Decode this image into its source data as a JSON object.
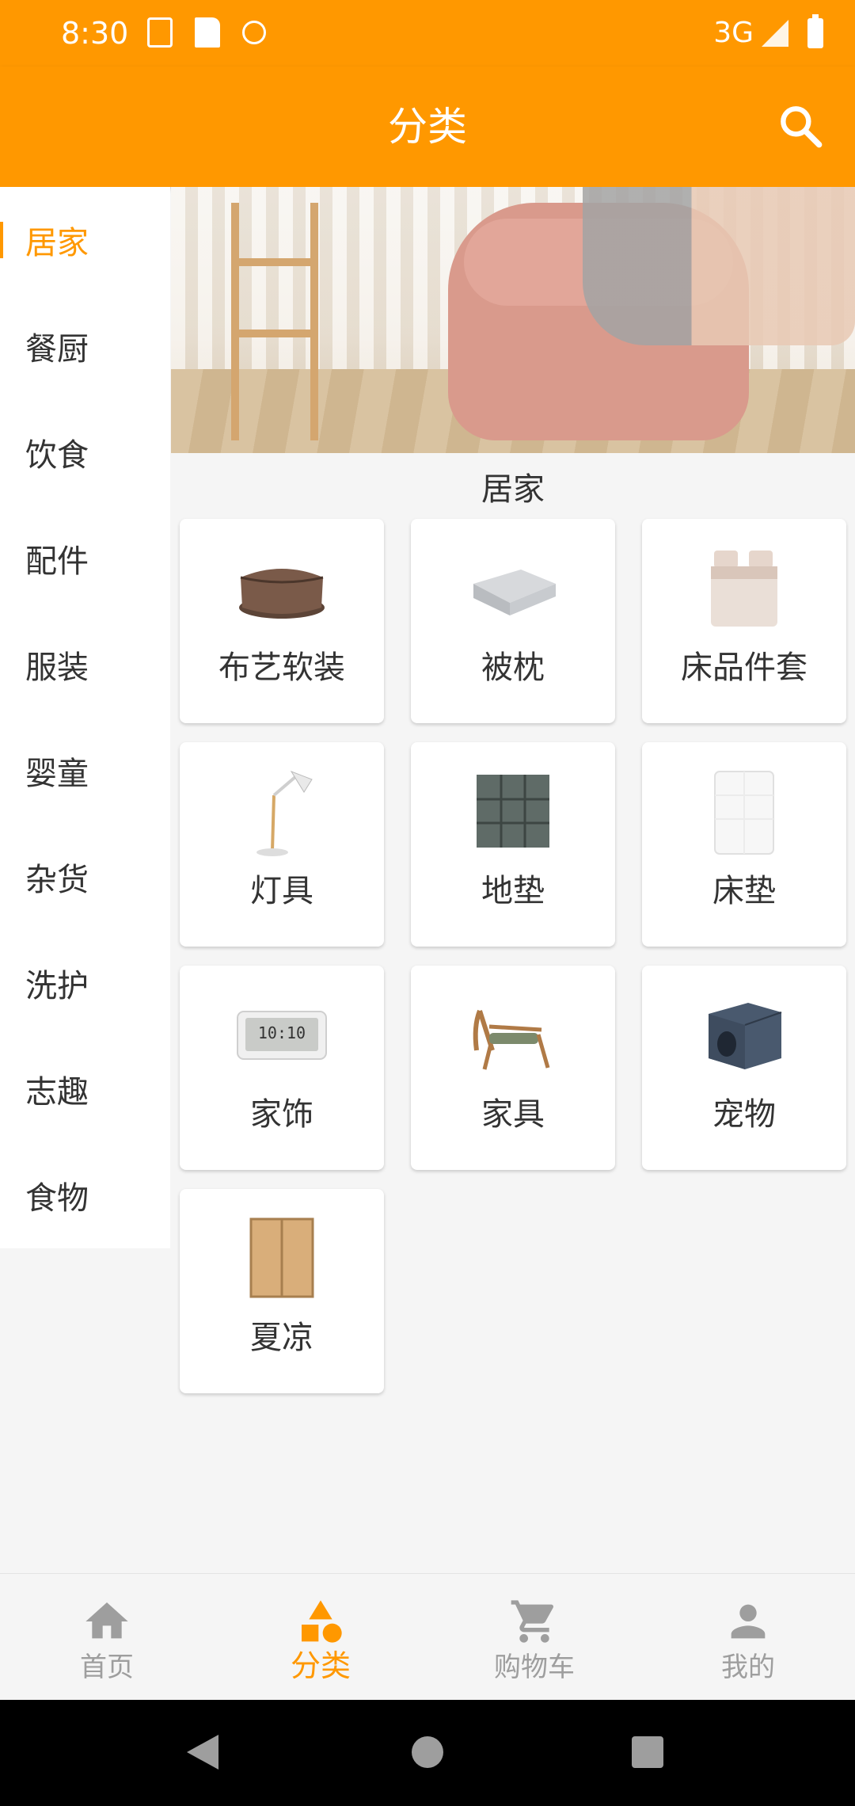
{
  "status_bar": {
    "time": "8:30",
    "network": "3G",
    "icons": [
      "text-notification-icon",
      "sd-card-icon",
      "sync-icon",
      "signal-icon",
      "battery-icon"
    ]
  },
  "app_bar": {
    "title": "分类",
    "search_icon": "search-icon"
  },
  "colors": {
    "accent": "#ff9800",
    "inactive": "#9e9e9e",
    "text": "#333333"
  },
  "sidebar": {
    "active_index": 0,
    "items": [
      {
        "label": "居家"
      },
      {
        "label": "餐厨"
      },
      {
        "label": "饮食"
      },
      {
        "label": "配件"
      },
      {
        "label": "服装"
      },
      {
        "label": "婴童"
      },
      {
        "label": "杂货"
      },
      {
        "label": "洗护"
      },
      {
        "label": "志趣"
      },
      {
        "label": "食物"
      }
    ]
  },
  "content": {
    "section_title": "居家",
    "banner_icon": "pink-pouf-banner-image",
    "categories": [
      {
        "label": "布艺软装",
        "icon": "bean-bag-icon"
      },
      {
        "label": "被枕",
        "icon": "quilt-icon"
      },
      {
        "label": "床品件套",
        "icon": "bedding-set-icon"
      },
      {
        "label": "灯具",
        "icon": "desk-lamp-icon"
      },
      {
        "label": "地垫",
        "icon": "floor-mat-icon"
      },
      {
        "label": "床垫",
        "icon": "mattress-icon"
      },
      {
        "label": "家饰",
        "icon": "digital-clock-icon"
      },
      {
        "label": "家具",
        "icon": "lounge-chair-icon"
      },
      {
        "label": "宠物",
        "icon": "pet-cube-icon"
      },
      {
        "label": "夏凉",
        "icon": "bamboo-mat-icon"
      }
    ]
  },
  "bottom_nav": {
    "active_index": 1,
    "items": [
      {
        "label": "首页",
        "icon": "home-icon"
      },
      {
        "label": "分类",
        "icon": "category-icon"
      },
      {
        "label": "购物车",
        "icon": "cart-icon"
      },
      {
        "label": "我的",
        "icon": "person-icon"
      }
    ]
  },
  "system_nav": [
    "back-icon",
    "home-circle-icon",
    "recents-icon"
  ]
}
